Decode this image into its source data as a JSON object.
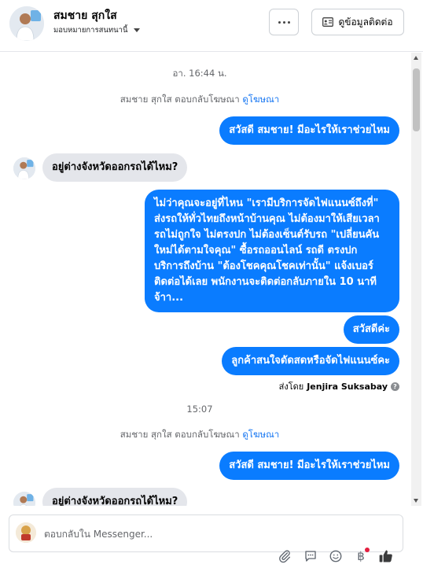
{
  "header": {
    "name": "สมชาย สุกใส",
    "assignment": "มอบหมายการสนทนานี้",
    "more_icon": "more-horizontal-icon",
    "contact_button": "ดูข้อมูลติดต่อ"
  },
  "thread": {
    "items": [
      {
        "kind": "timestamp",
        "text": "อา. 16:44 น."
      },
      {
        "kind": "note",
        "text": "สมชาย สุกใส ตอบกลับโฆษณา",
        "link": "ดูโฆษณา"
      },
      {
        "kind": "outgoing",
        "text": "สวัสดี สมชาย! มีอะไรให้เราช่วยไหม"
      },
      {
        "kind": "incoming",
        "text": "อยู่ต่างจังหวัดออกรถได้ไหม?"
      },
      {
        "kind": "outgoing",
        "text": "ไม่ว่าคุณจะอยู่ที่ไหน \"เรามีบริการจัดไฟแนนซ์ถึงที่\" ส่งรถให้ทั่วไทยถึงหน้าบ้านคุณ ไม่ต้องมาให้เสียเวลา รถไม่ถูกใจ ไม่ตรงปก ไม่ต้องเซ็นต์รับรถ \"เปลี่ยนคันใหม่ได้ตามใจคุณ\" ซื้อรถออนไลน์ รถดี ตรงปก บริการถึงบ้าน \"ต้องโชคคุณโชคเท่านั้น\" แจ้งเบอร์ติดต่อได้เลย พนักงานจะติดต่อกลับภายใน 10 นาที จ้าา..."
      },
      {
        "kind": "outgoing",
        "text": "สวัสดีค่ะ"
      },
      {
        "kind": "outgoing",
        "text": "ลูกค้าสนใจดัดสดหรือจัดไฟแนนซ์คะ"
      },
      {
        "kind": "sent_by",
        "prefix": "ส่งโดย",
        "name": "Jenjira Suksabay",
        "help": "?"
      },
      {
        "kind": "timestamp",
        "text": "15:07"
      },
      {
        "kind": "note",
        "text": "สมชาย สุกใส ตอบกลับโฆษณา",
        "link": "ดูโฆษณา"
      },
      {
        "kind": "outgoing",
        "text": "สวัสดี สมชาย! มีอะไรให้เราช่วยไหม"
      },
      {
        "kind": "incoming",
        "text": "อยู่ต่างจังหวัดออกรถได้ไหม?"
      }
    ]
  },
  "composer": {
    "placeholder": "ตอบกลับใน Messenger..."
  },
  "toolbar": {
    "icons": [
      "attachment-icon",
      "saved-reply-icon",
      "emoji-icon",
      "payment-icon",
      "like-icon"
    ]
  },
  "colors": {
    "outgoing_bubble": "#0a7cff",
    "incoming_bubble": "#e4e6eb",
    "link": "#1877f2",
    "notification_dot": "#e41e3f"
  }
}
